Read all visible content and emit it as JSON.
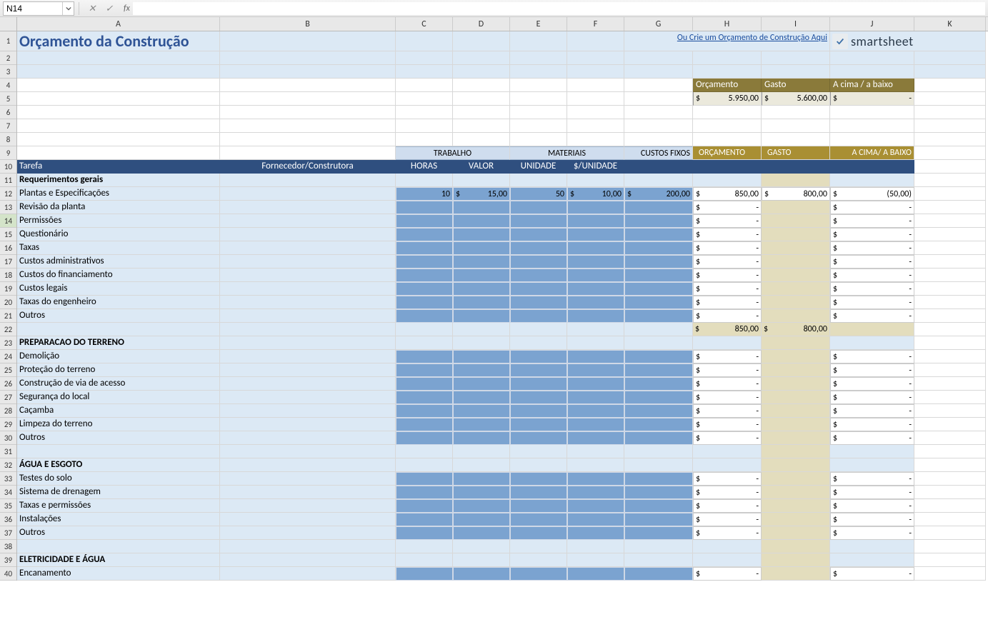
{
  "namebox": "N14",
  "formula": "",
  "cols": [
    "A",
    "B",
    "C",
    "D",
    "E",
    "F",
    "G",
    "H",
    "I",
    "J",
    "K"
  ],
  "selectedRow": 14,
  "title": "Orçamento da Construção",
  "link": "Ou Crie um Orçamento de Construção Aqui",
  "logo": "smartsheet",
  "summary": {
    "h": [
      "Orçamento",
      "Gasto",
      "A cima / a baixo"
    ],
    "vals": [
      "5.950,00",
      "5.600,00",
      "-"
    ]
  },
  "group9": {
    "trabalho": "TRABALHO",
    "materiais": "MATERIAIS",
    "custos": "CUSTOS FIXOS",
    "orc": "ORÇAMENTO",
    "gasto": "GASTO",
    "acima": "A CIMA/ A BAIXO"
  },
  "hdr10": {
    "tarefa": "Tarefa",
    "forn": "Fornecedor/Construtora",
    "horas": "HORAS",
    "valor": "VALOR",
    "unidade": "UNIDADE",
    "pun": "$/UNIDADE"
  },
  "sections": [
    {
      "title": "Requerimentos gerais",
      "rows": [
        {
          "label": "Plantas e Especificações",
          "horas": "10",
          "valor": "15,00",
          "un": "50",
          "pun": "10,00",
          "fix": "200,00",
          "orc": "850,00",
          "gasto": "800,00",
          "diff": "(50,00)"
        },
        {
          "label": "Revisão da planta"
        },
        {
          "label": "Permissões"
        },
        {
          "label": "Questionário"
        },
        {
          "label": "Taxas"
        },
        {
          "label": "Custos administrativos"
        },
        {
          "label": "Custos do financiamento"
        },
        {
          "label": "Custos legais"
        },
        {
          "label": "Taxas do engenheiro"
        },
        {
          "label": "Outros"
        }
      ],
      "subtotal": {
        "orc": "850,00",
        "gasto": "800,00"
      }
    },
    {
      "title": "PREPARACAO DO TERRENO",
      "rows": [
        {
          "label": "Demolição"
        },
        {
          "label": "Proteção do terreno"
        },
        {
          "label": "Construção de via de acesso"
        },
        {
          "label": "Segurança do local"
        },
        {
          "label": "Caçamba"
        },
        {
          "label": "Limpeza do terreno"
        },
        {
          "label": "Outros"
        }
      ]
    },
    {
      "title": "ÁGUA E ESGOTO",
      "spacerBefore": true,
      "rows": [
        {
          "label": "Testes do solo"
        },
        {
          "label": "Sistema de drenagem"
        },
        {
          "label": "Taxas e permissões"
        },
        {
          "label": "Instalações"
        },
        {
          "label": "Outros"
        }
      ]
    },
    {
      "title": "ELETRICIDADE E ÁGUA",
      "spacerBefore": true,
      "rows": [
        {
          "label": "Encanamento"
        }
      ]
    }
  ],
  "cur": "$",
  "dash": "-"
}
